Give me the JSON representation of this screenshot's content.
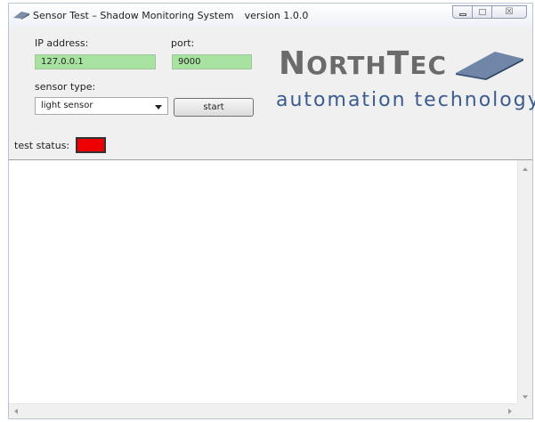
{
  "window": {
    "title": "Sensor Test – Shadow Monitoring System",
    "version": "version 1.0.0",
    "close_glyph": "☒"
  },
  "form": {
    "ip_label": "IP address:",
    "ip_value": "127.0.0.1",
    "port_label": "port:",
    "port_value": "9000",
    "sensor_type_label": "sensor type:",
    "sensor_type_value": "light sensor",
    "start_label": "start",
    "test_status_label": "test status:"
  },
  "logo": {
    "brand_first": "N",
    "brand_small": "ORTH",
    "brand_second": "T",
    "brand_small2": "EC",
    "tagline": "automation technology"
  },
  "colors": {
    "field_bg": "#a8e2a0",
    "status": "#ee0000",
    "logo_gray": "#6b6b6b",
    "logo_blue": "#3b5c8f"
  },
  "log": {
    "text": ""
  }
}
